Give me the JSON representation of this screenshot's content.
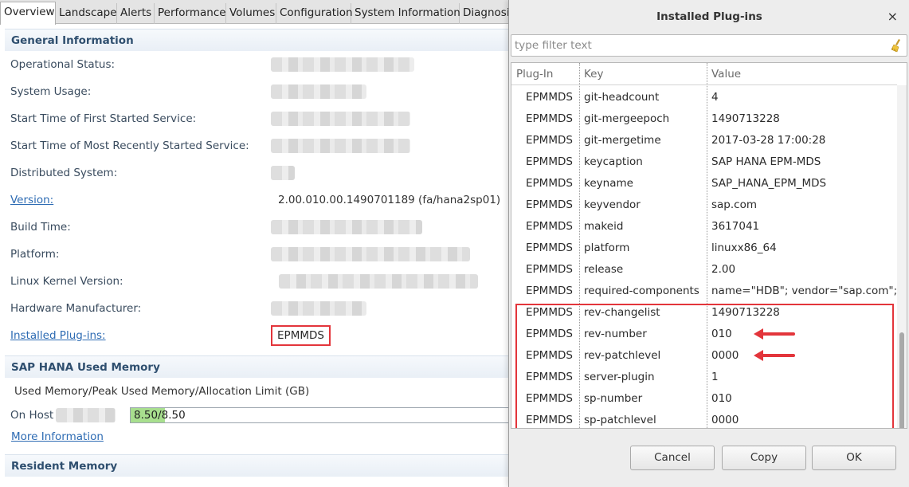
{
  "tabs": [
    "Overview",
    "Landscape",
    "Alerts",
    "Performance",
    "Volumes",
    "Configuration",
    "System Information",
    "Diagnosis"
  ],
  "general": {
    "header": "General Information",
    "labels": {
      "operational_status": "Operational Status:",
      "system_usage": "System Usage:",
      "start_first": "Start Time of First Started Service:",
      "start_recent": "Start Time of Most Recently Started Service:",
      "distributed": "Distributed System:",
      "version": "Version:",
      "build_time": "Build Time:",
      "platform": "Platform:",
      "kernel": "Linux Kernel Version:",
      "hardware": "Hardware Manufacturer:",
      "plugins": "Installed Plug-ins:"
    },
    "version_value": "2.00.010.00.1490701189 (fa/hana2sp01)",
    "plugins_value": "EPMMDS"
  },
  "memory": {
    "header": "SAP HANA Used Memory",
    "caption": "Used Memory/Peak Used Memory/Allocation Limit (GB)",
    "host_label": "On Host",
    "bar_text": "8.50/8.50",
    "bar_fraction": 0.09,
    "more_link": "More Information"
  },
  "resident": {
    "header": "Resident Memory"
  },
  "dialog": {
    "title": "Installed Plug-ins",
    "close": "×",
    "filter_placeholder": "type filter text",
    "columns": [
      "Plug-In",
      "Key",
      "Value"
    ],
    "rows": [
      [
        "EPMMDS",
        "git-headcount",
        "4"
      ],
      [
        "EPMMDS",
        "git-mergeepoch",
        "1490713228"
      ],
      [
        "EPMMDS",
        "git-mergetime",
        "2017-03-28 17:00:28"
      ],
      [
        "EPMMDS",
        "keycaption",
        "SAP HANA EPM-MDS"
      ],
      [
        "EPMMDS",
        "keyname",
        "SAP_HANA_EPM_MDS"
      ],
      [
        "EPMMDS",
        "keyvendor",
        "sap.com"
      ],
      [
        "EPMMDS",
        "makeid",
        "3617041"
      ],
      [
        "EPMMDS",
        "platform",
        "linuxx86_64"
      ],
      [
        "EPMMDS",
        "release",
        "2.00"
      ],
      [
        "EPMMDS",
        "required-components",
        "name=\"HDB\"; vendor=\"sap.com\"; v"
      ],
      [
        "EPMMDS",
        "rev-changelist",
        "1490713228"
      ],
      [
        "EPMMDS",
        "rev-number",
        "010"
      ],
      [
        "EPMMDS",
        "rev-patchlevel",
        "0000"
      ],
      [
        "EPMMDS",
        "server-plugin",
        "1"
      ],
      [
        "EPMMDS",
        "sp-number",
        "010"
      ],
      [
        "EPMMDS",
        "sp-patchlevel",
        "0000"
      ]
    ],
    "buttons": {
      "cancel": "Cancel",
      "copy": "Copy",
      "ok": "OK"
    }
  }
}
